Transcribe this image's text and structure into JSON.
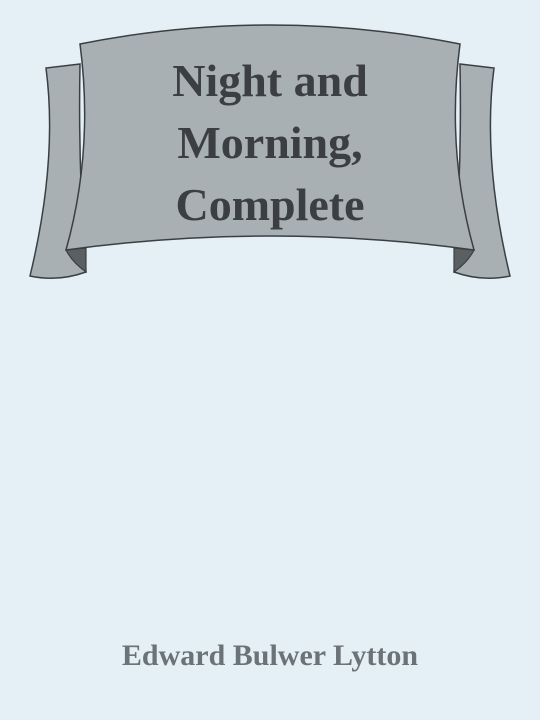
{
  "book": {
    "title_lines": [
      "Night and",
      "Morning,",
      "Complete"
    ],
    "author": "Edward Bulwer Lytton"
  },
  "colors": {
    "background": "#e4f0f5",
    "ribbon_fill": "#a8b0b4",
    "ribbon_fold": "#5a5f62",
    "ribbon_outline": "#3b3f42",
    "title_text": "#3b3f42",
    "author_text": "#6b7378"
  }
}
